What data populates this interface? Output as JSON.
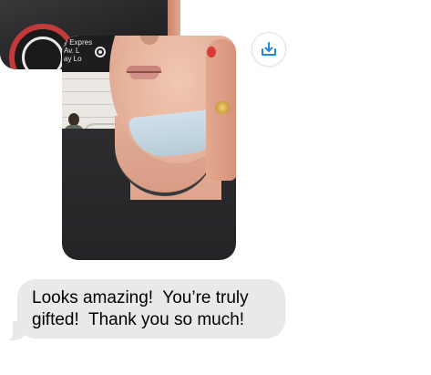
{
  "conversation": {
    "messages": [
      {
        "type": "photo",
        "direction": "incoming",
        "state": "partially-scrolled"
      },
      {
        "type": "photo",
        "direction": "incoming",
        "photo_sign_text": "y Expres\nAv. L\nay Lo",
        "save_action": {
          "icon": "download-tray-icon",
          "color": "#1e88e5"
        }
      },
      {
        "type": "text",
        "direction": "incoming",
        "lines": [
          "Looks amazing!  You’re truly",
          "gifted!  Thank you so much!"
        ],
        "bubble_color": "#e9e9eb"
      }
    ]
  }
}
